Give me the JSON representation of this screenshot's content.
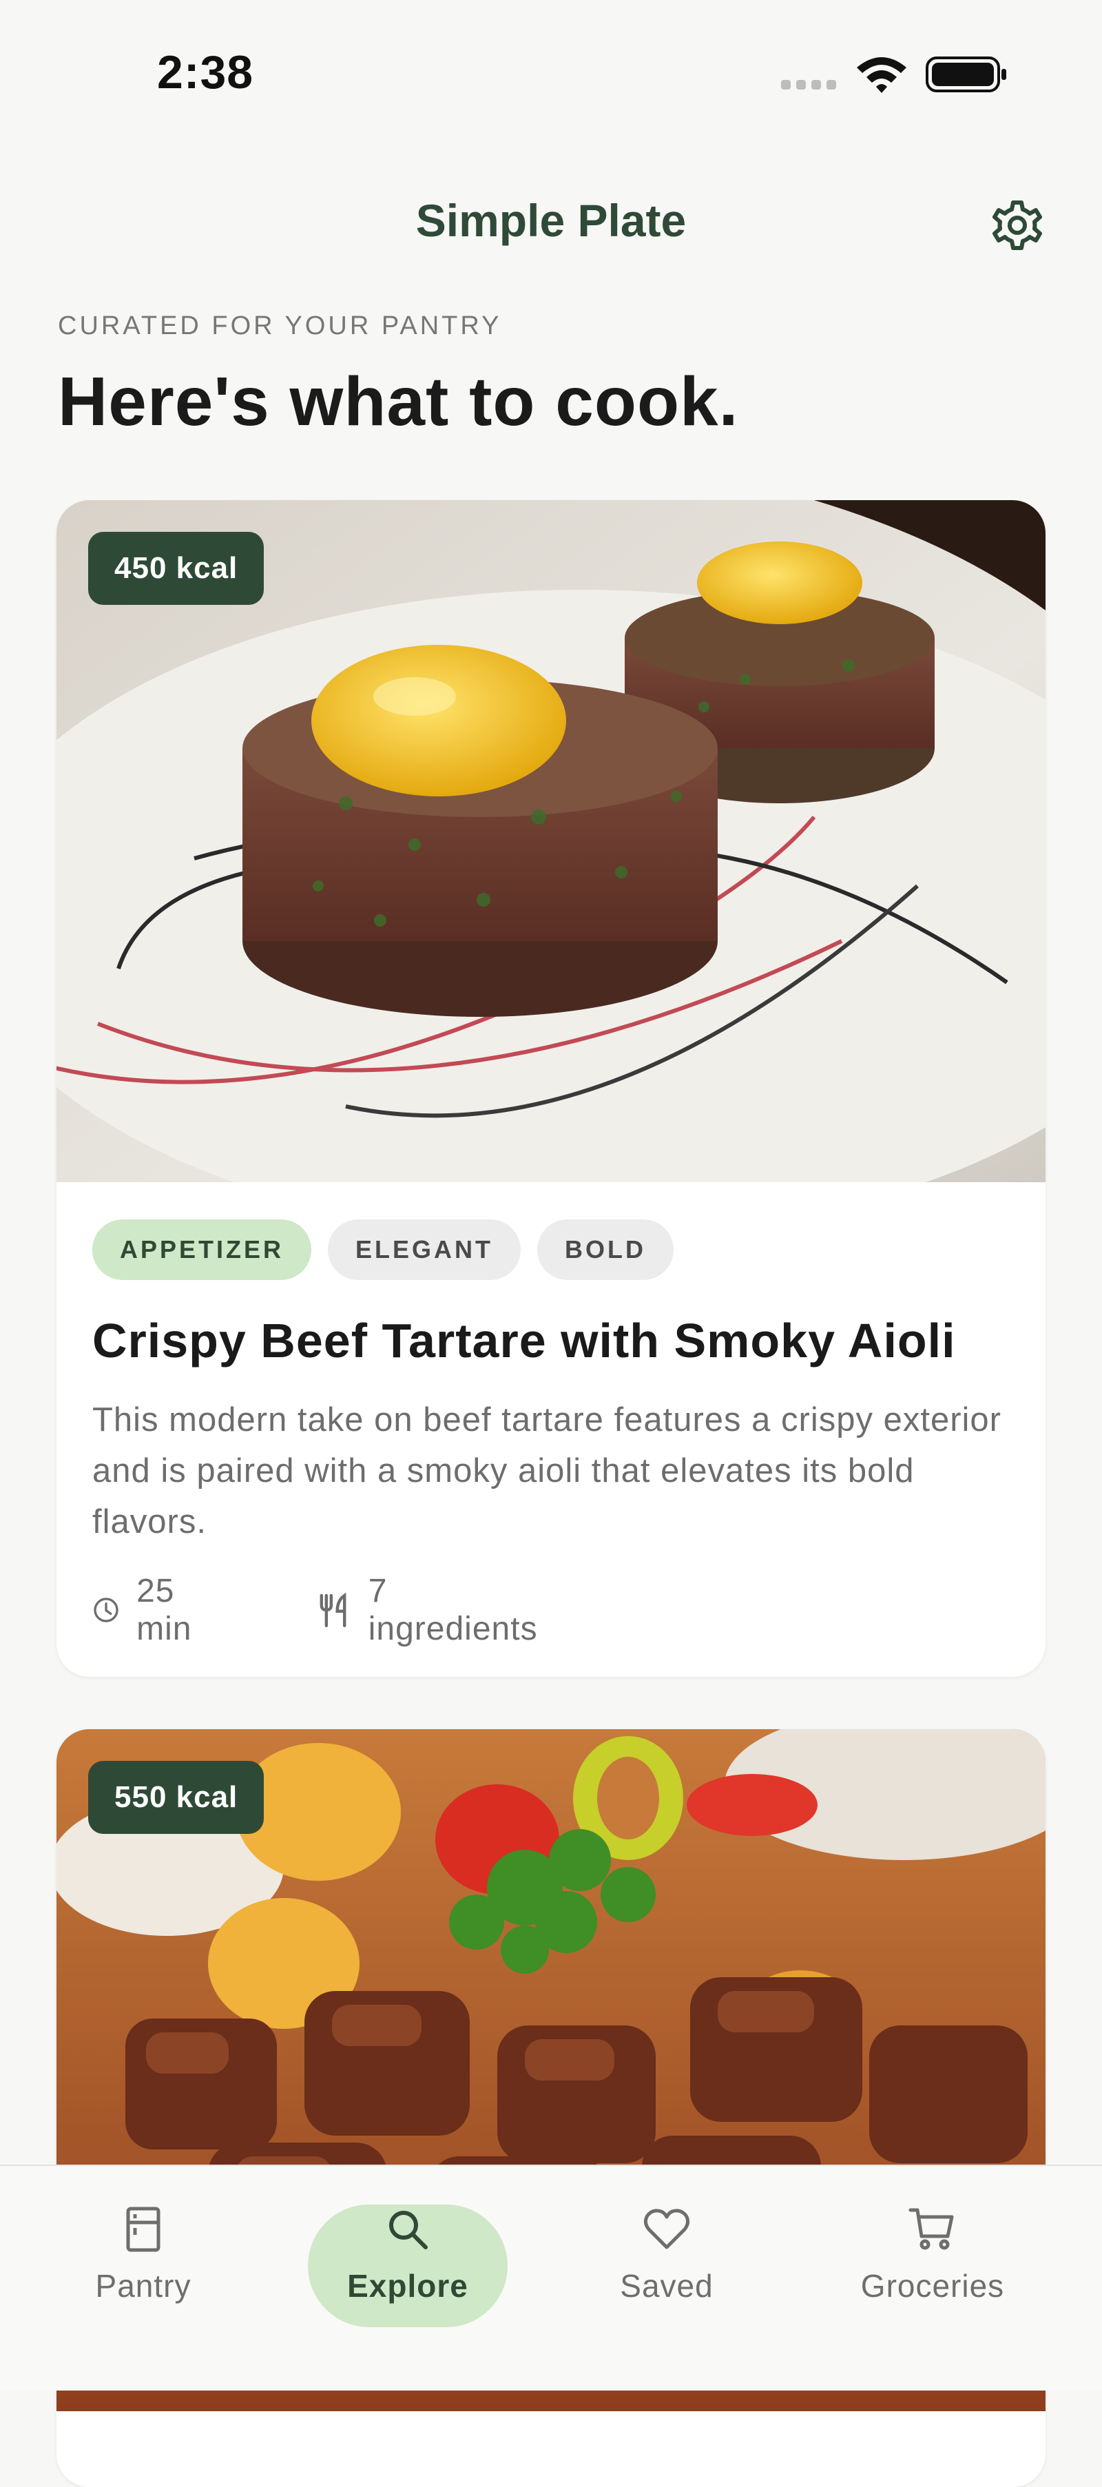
{
  "status_bar": {
    "time": "2:38"
  },
  "header": {
    "title": "Simple Plate"
  },
  "intro": {
    "eyebrow": "CURATED FOR YOUR PANTRY",
    "headline": "Here's what to cook."
  },
  "recipes": [
    {
      "kcal": "450 kcal",
      "tags": [
        "APPETIZER",
        "ELEGANT",
        "BOLD"
      ],
      "title": "Crispy Beef Tartare with Smoky Aioli",
      "description": "This modern take on beef tartare features a crispy exterior and is paired with a smoky aioli that elevates its bold flavors.",
      "time": "25 min",
      "ingredients": "7 ingredients"
    },
    {
      "kcal": "550 kcal"
    }
  ],
  "bottom_nav": {
    "items": [
      {
        "label": "Pantry",
        "icon": "pantry-icon"
      },
      {
        "label": "Explore",
        "icon": "search-icon"
      },
      {
        "label": "Saved",
        "icon": "heart-icon"
      },
      {
        "label": "Groceries",
        "icon": "cart-icon"
      }
    ],
    "active": "Explore"
  },
  "colors": {
    "brand": "#2e4a36",
    "accent_tag": "#cfe8c7",
    "background": "#f7f7f5"
  }
}
